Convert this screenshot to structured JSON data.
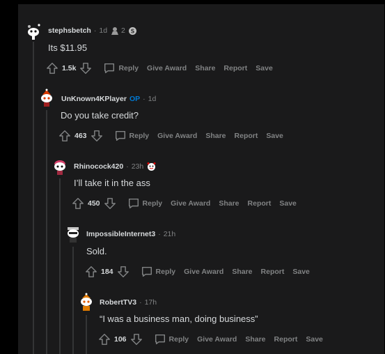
{
  "comments": [
    {
      "username": "stephsbetch",
      "op_label": "",
      "time": "1d",
      "award_count": "2",
      "body": "Its $11.95",
      "score": "1.5k",
      "actions": {
        "reply": "Reply",
        "give_award": "Give Award",
        "share": "Share",
        "report": "Report",
        "save": "Save"
      }
    },
    {
      "username": "UnKnown4KPlayer",
      "op_label": "OP",
      "time": "1d",
      "award_count": "",
      "body": "Do you take credit?",
      "score": "463",
      "actions": {
        "reply": "Reply",
        "give_award": "Give Award",
        "share": "Share",
        "report": "Report",
        "save": "Save"
      }
    },
    {
      "username": "Rhinocock420",
      "op_label": "",
      "time": "23h",
      "award_count": "",
      "body": "I’ll take it in the ass",
      "score": "450",
      "actions": {
        "reply": "Reply",
        "give_award": "Give Award",
        "share": "Share",
        "report": "Report",
        "save": "Save"
      }
    },
    {
      "username": "ImpossibleInternet3",
      "op_label": "",
      "time": "21h",
      "award_count": "",
      "body": "Sold.",
      "score": "184",
      "actions": {
        "reply": "Reply",
        "give_award": "Give Award",
        "share": "Share",
        "report": "Report",
        "save": "Save"
      }
    },
    {
      "username": "RobertTV3",
      "op_label": "",
      "time": "17h",
      "award_count": "",
      "body": "“I was a business man, doing business”",
      "score": "106",
      "actions": {
        "reply": "Reply",
        "give_award": "Give Award",
        "share": "Share",
        "report": "Report",
        "save": "Save"
      }
    }
  ],
  "separator": "·",
  "colors": {
    "background": "#1a1a1b",
    "text": "#d7dadc",
    "muted": "#818384",
    "op": "#0079d3",
    "thread_line": "#343536"
  }
}
